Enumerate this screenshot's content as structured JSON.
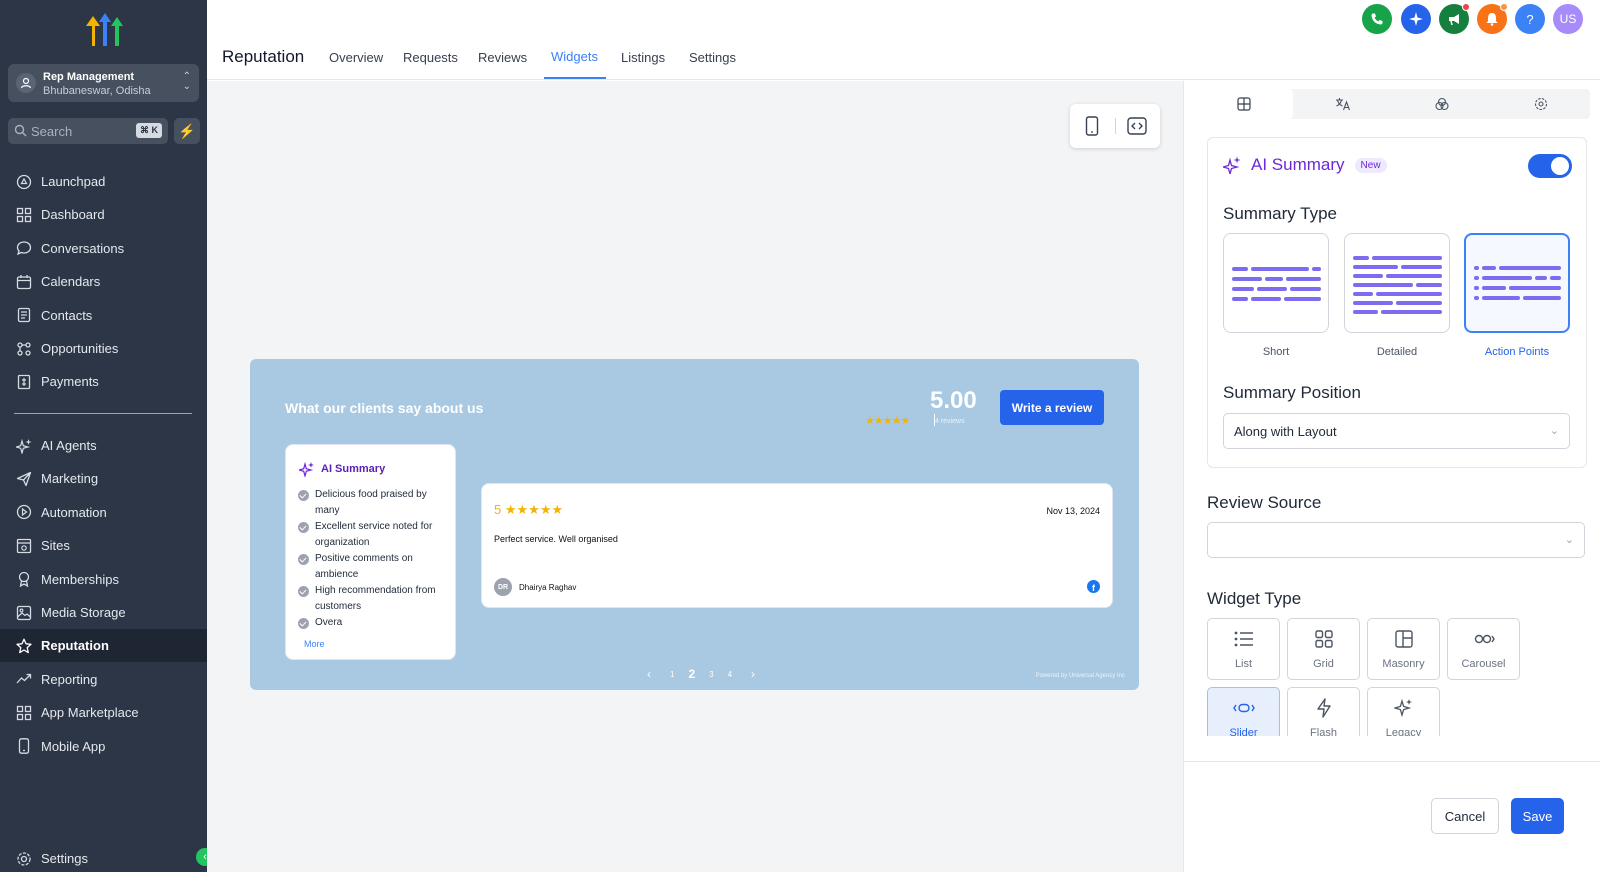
{
  "sidebar": {
    "account": {
      "name": "Rep Management",
      "location": "Bhubaneswar, Odisha"
    },
    "search": {
      "placeholder": "Search",
      "shortcut": "⌘ K"
    },
    "items_top": [
      {
        "label": "Launchpad",
        "icon": "rocket-icon"
      },
      {
        "label": "Dashboard",
        "icon": "grid-icon"
      },
      {
        "label": "Conversations",
        "icon": "chat-icon"
      },
      {
        "label": "Calendars",
        "icon": "calendar-icon"
      },
      {
        "label": "Contacts",
        "icon": "contacts-icon"
      },
      {
        "label": "Opportunities",
        "icon": "funnel-icon"
      },
      {
        "label": "Payments",
        "icon": "payments-icon"
      }
    ],
    "items_bottom": [
      {
        "label": "AI Agents",
        "icon": "sparkle-icon"
      },
      {
        "label": "Marketing",
        "icon": "send-icon"
      },
      {
        "label": "Automation",
        "icon": "automation-icon"
      },
      {
        "label": "Sites",
        "icon": "sites-icon"
      },
      {
        "label": "Memberships",
        "icon": "badge-icon"
      },
      {
        "label": "Media Storage",
        "icon": "image-icon"
      },
      {
        "label": "Reputation",
        "icon": "star-icon",
        "active": true
      },
      {
        "label": "Reporting",
        "icon": "trend-icon"
      },
      {
        "label": "App Marketplace",
        "icon": "apps-icon"
      },
      {
        "label": "Mobile App",
        "icon": "phone-icon"
      }
    ],
    "settings": "Settings"
  },
  "header": {
    "title": "Reputation",
    "tabs": [
      "Overview",
      "Requests",
      "Reviews",
      "Widgets",
      "Listings",
      "Settings"
    ],
    "active_tab": "Widgets",
    "user_initials": "US",
    "help": "?"
  },
  "widget": {
    "title": "What our clients say about us",
    "rating": "5.00",
    "review_count": "4 reviews",
    "write_button": "Write a review",
    "ai_summary": {
      "title": "AI Summary",
      "points": [
        "Delicious food praised by many",
        "Excellent service noted for organization",
        "Positive comments on ambience",
        "High recommendation from customers",
        "Overa"
      ],
      "more": "More"
    },
    "review": {
      "stars": "5",
      "star_glyphs": "★★★★★",
      "date": "Nov 13, 2024",
      "text": "Perfect service. Well organised",
      "author_initials": "DR",
      "author": "Dhairya Raghav",
      "source_icon": "facebook-icon"
    },
    "pager": {
      "prev": "‹",
      "pages": [
        "1",
        "2",
        "3",
        "4"
      ],
      "current": "2",
      "next": "›"
    },
    "powered_by": "Powered by Universal Agency Inc"
  },
  "panel": {
    "ai_summary": {
      "title": "AI Summary",
      "badge": "New",
      "enabled": true
    },
    "summary_type": {
      "label": "Summary Type",
      "options": [
        "Short",
        "Detailed",
        "Action Points"
      ],
      "selected": "Action Points"
    },
    "summary_position": {
      "label": "Summary Position",
      "value": "Along with Layout"
    },
    "review_source": {
      "label": "Review Source",
      "value": ""
    },
    "widget_type": {
      "label": "Widget Type",
      "options": [
        "List",
        "Grid",
        "Masonry",
        "Carousel",
        "Slider",
        "Flash",
        "Legacy"
      ],
      "selected": "Slider"
    },
    "cancel": "Cancel",
    "save": "Save"
  },
  "colors": {
    "sidebar_bg": "#2c3646",
    "accent": "#2563eb",
    "widget_bg": "#a9c9e2",
    "ai_purple": "#6d28d9"
  }
}
